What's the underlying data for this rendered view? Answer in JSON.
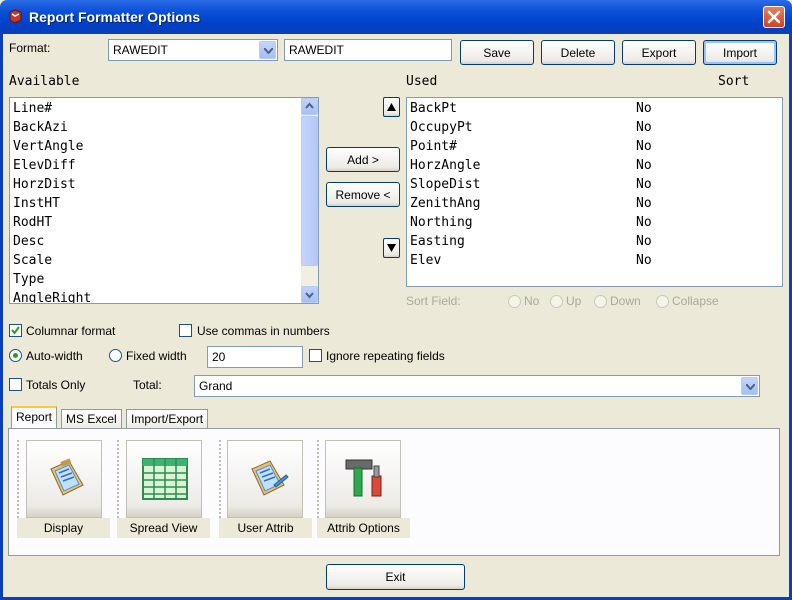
{
  "window": {
    "title": "Report Formatter Options"
  },
  "format": {
    "label": "Format:",
    "selected": "RAWEDIT",
    "name_value": "RAWEDIT",
    "buttons": {
      "save": "Save",
      "delete": "Delete",
      "export": "Export",
      "import": "Import"
    }
  },
  "available": {
    "header": "Available",
    "items": [
      "Line#",
      "BackAzi",
      "VertAngle",
      "ElevDiff",
      "HorzDist",
      "InstHT",
      "RodHT",
      "Desc",
      "Scale",
      "Type",
      "AngleRight"
    ]
  },
  "move_buttons": {
    "add": "Add >",
    "remove": "Remove <"
  },
  "used": {
    "header": "Used",
    "sort_header": "Sort",
    "items": [
      {
        "name": "BackPt",
        "sort": "No"
      },
      {
        "name": "OccupyPt",
        "sort": "No"
      },
      {
        "name": "Point#",
        "sort": "No"
      },
      {
        "name": "HorzAngle",
        "sort": "No"
      },
      {
        "name": "SlopeDist",
        "sort": "No"
      },
      {
        "name": "ZenithAng",
        "sort": "No"
      },
      {
        "name": "Northing",
        "sort": "No"
      },
      {
        "name": "Easting",
        "sort": "No"
      },
      {
        "name": "Elev",
        "sort": "No"
      }
    ]
  },
  "sort_field": {
    "label": "Sort Field:",
    "options": [
      "No",
      "Up",
      "Down",
      "Collapse"
    ]
  },
  "options": {
    "columnar_format": "Columnar format",
    "columnar_checked": true,
    "use_commas": "Use commas in numbers",
    "use_commas_checked": false,
    "auto_width": "Auto-width",
    "fixed_width": "Fixed width",
    "width_value": "20",
    "ignore_repeating": "Ignore repeating fields",
    "totals_only": "Totals Only",
    "total_label": "Total:",
    "total_selected": "Grand"
  },
  "tabs": [
    "Report",
    "MS Excel",
    "Import/Export"
  ],
  "tools": [
    {
      "label": "Display",
      "icon": "clipboard-report-icon"
    },
    {
      "label": "Spread View",
      "icon": "spreadsheet-icon"
    },
    {
      "label": "User Attrib",
      "icon": "clipboard-edit-icon"
    },
    {
      "label": "Attrib Options",
      "icon": "tools-icon"
    }
  ],
  "exit_label": "Exit",
  "colors": {
    "title_bar": "#0a4fd6",
    "close_button": "#d3411e",
    "dialog_bg": "#ece9d8"
  }
}
